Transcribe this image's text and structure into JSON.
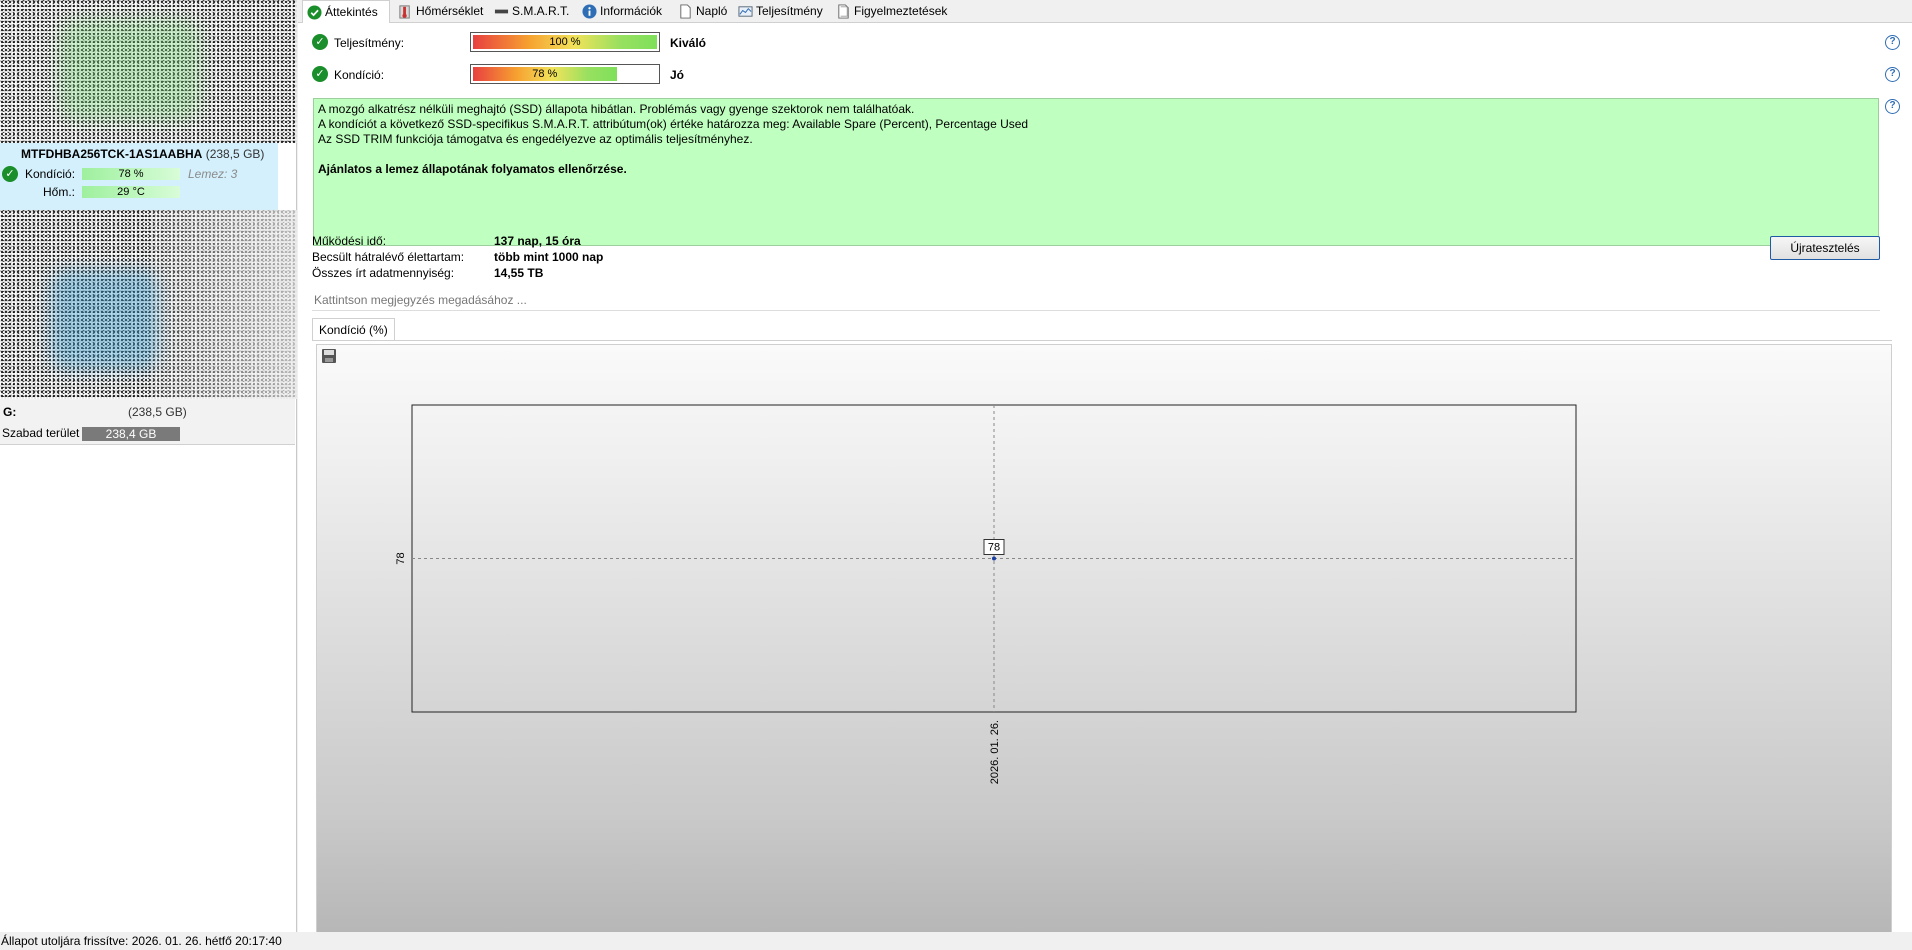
{
  "tabs": [
    {
      "label": "Áttekintés",
      "icon": "check-circle-icon",
      "active": true
    },
    {
      "label": "Hőmérséklet",
      "icon": "thermometer-icon",
      "active": false
    },
    {
      "label": "S.M.A.R.T.",
      "icon": "drive-icon",
      "active": false
    },
    {
      "label": "Információk",
      "icon": "info-icon",
      "active": false
    },
    {
      "label": "Napló",
      "icon": "document-icon",
      "active": false
    },
    {
      "label": "Teljesítmény",
      "icon": "performance-chart-icon",
      "active": false
    },
    {
      "label": "Figyelmeztetések",
      "icon": "alerts-icon",
      "active": false
    }
  ],
  "sidebar": {
    "disk1": {
      "model": "MTFDHBA256TCK-1AS1AABHA",
      "size": "(238,5 GB)",
      "condition_label": "Kondíció:",
      "condition_value": "78 %",
      "disk_number": "Lemez: 3",
      "temp_label": "Hőm.:",
      "temp_value": "29 °C"
    },
    "disk2": {
      "letter": "G:",
      "size": "(238,5 GB)",
      "free_label": "Szabad terület",
      "free_value": "238,4 GB"
    }
  },
  "overview": {
    "performance": {
      "label": "Teljesítmény:",
      "percent_text": "100 %",
      "percent": 100,
      "rating": "Kiváló"
    },
    "condition": {
      "label": "Kondíció:",
      "percent_text": "78 %",
      "percent": 78,
      "rating": "Jó"
    },
    "info_lines": [
      "A mozgó alkatrész nélküli meghajtó (SSD) állapota hibátlan. Problémás vagy gyenge szektorok nem találhatóak.",
      "A kondíciót a következő SSD-specifikus S.M.A.R.T. attribútum(ok) értéke határozza meg:  Available Spare (Percent), Percentage Used",
      "Az SSD TRIM funkciója támogatva és engedélyezve az optimális teljesítményhez."
    ],
    "recommendation": "Ajánlatos a lemez állapotának folyamatos ellenőrzése.",
    "uptime_label": "Működési idő:",
    "uptime_value": "137 nap, 15 óra",
    "lifetime_label": "Becsült hátralévő élettartam:",
    "lifetime_value": "több mint 1000 nap",
    "written_label": "Összes írt adatmennyiség:",
    "written_value": "14,55 TB",
    "retest_button": "Újratesztelés",
    "note_placeholder": "Kattintson megjegyzés megadásához ..."
  },
  "chart_tab": "Kondíció  (%)",
  "chart_data": {
    "type": "line",
    "title": "",
    "xlabel": "",
    "ylabel": "",
    "x": [
      "2026. 01. 26."
    ],
    "series": [
      {
        "values": [
          78
        ]
      }
    ],
    "y_ticks": [
      "78"
    ],
    "data_labels": [
      "78"
    ],
    "grid": true
  },
  "status_bar": "Állapot utoljára frissítve: 2026. 01. 26. hétfő 20:17:40",
  "colors": {
    "good_green": "#1a8e2a",
    "info_box": "#bfffbf",
    "selected_disk": "#d4f0fc",
    "help_blue": "#2f6db5"
  }
}
